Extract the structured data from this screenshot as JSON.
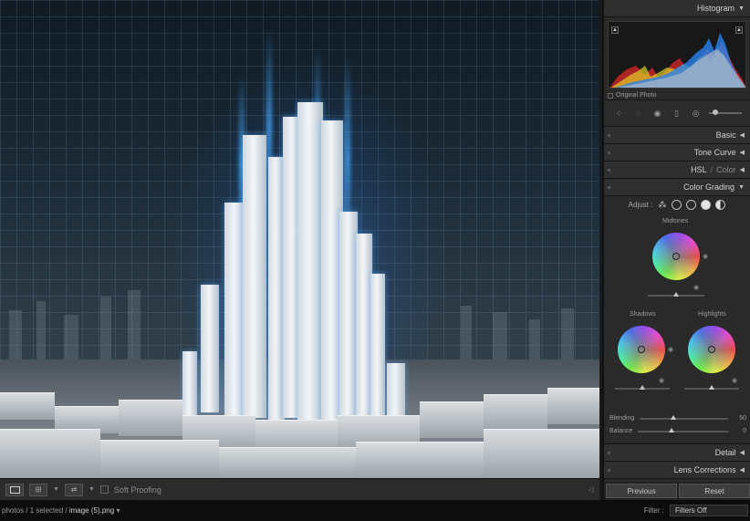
{
  "panels": {
    "histogram": "Histogram",
    "original_photo": "Original Photo",
    "basic": "Basic",
    "tone_curve": "Tone Curve",
    "hsl": "HSL",
    "hsl_sep": "/",
    "color": "Color",
    "color_grading": "Color Grading",
    "detail": "Detail",
    "lens_corrections": "Lens Corrections"
  },
  "color_grading": {
    "adjust_label": "Adjust :",
    "midtones": "Midtones",
    "shadows": "Shadows",
    "highlights": "Highlights",
    "blending_label": "Blending",
    "blending_value": "50",
    "balance_label": "Balance",
    "balance_value": "0"
  },
  "buttons": {
    "previous": "Previous",
    "reset": "Reset"
  },
  "toolbar": {
    "soft_proofing": "Soft Proofing"
  },
  "status": {
    "prefix": "photos / 1 selected /",
    "filename": "image (5).png",
    "filter_label": "Filter :",
    "filter_value": "Filters Off"
  },
  "icons": {
    "collapse": "▼",
    "expand": "◀"
  }
}
